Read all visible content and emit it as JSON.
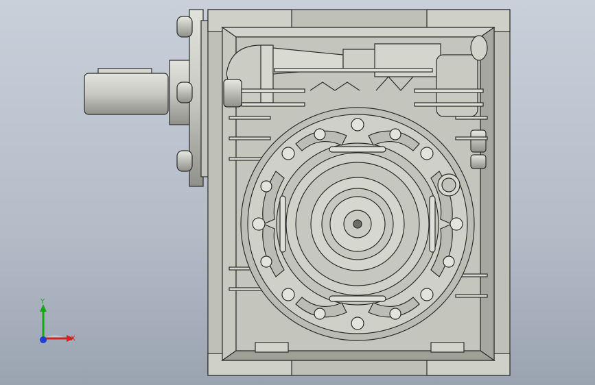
{
  "viewport": {
    "background_top": "#c9d0da",
    "background_bottom": "#9aa3b0",
    "part_color": "#c9cbc2",
    "part_shadow": "#a5a79f",
    "edge_color": "#2b2b2b"
  },
  "triad": {
    "y_label": "Y",
    "x_label": "X",
    "y_color": "#1aa61a",
    "x_color": "#d42020",
    "z_color": "#1e3fd0"
  }
}
